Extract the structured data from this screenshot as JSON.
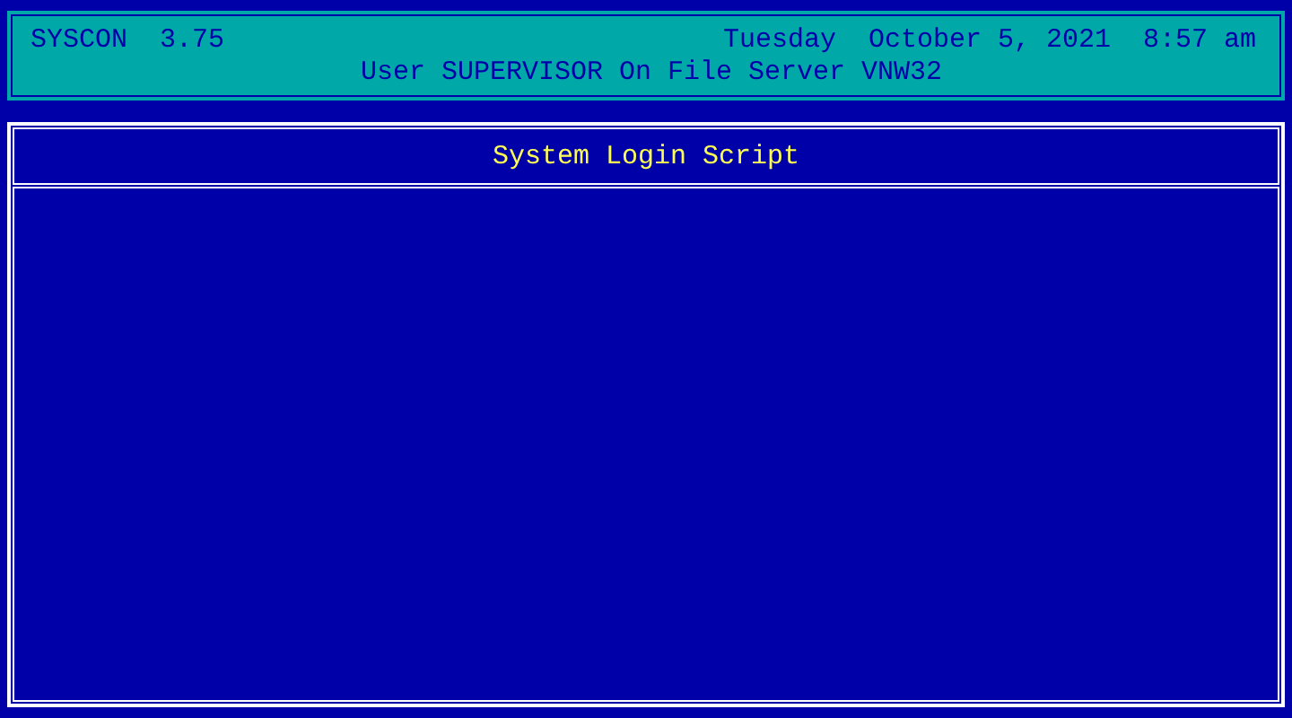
{
  "header": {
    "program": "SYSCON",
    "version": "3.75",
    "date": "Tuesday  October 5, 2021",
    "time": "8:57 am",
    "user_line": "User SUPERVISOR On File Server VNW32"
  },
  "panel": {
    "title": "System Login Script"
  }
}
